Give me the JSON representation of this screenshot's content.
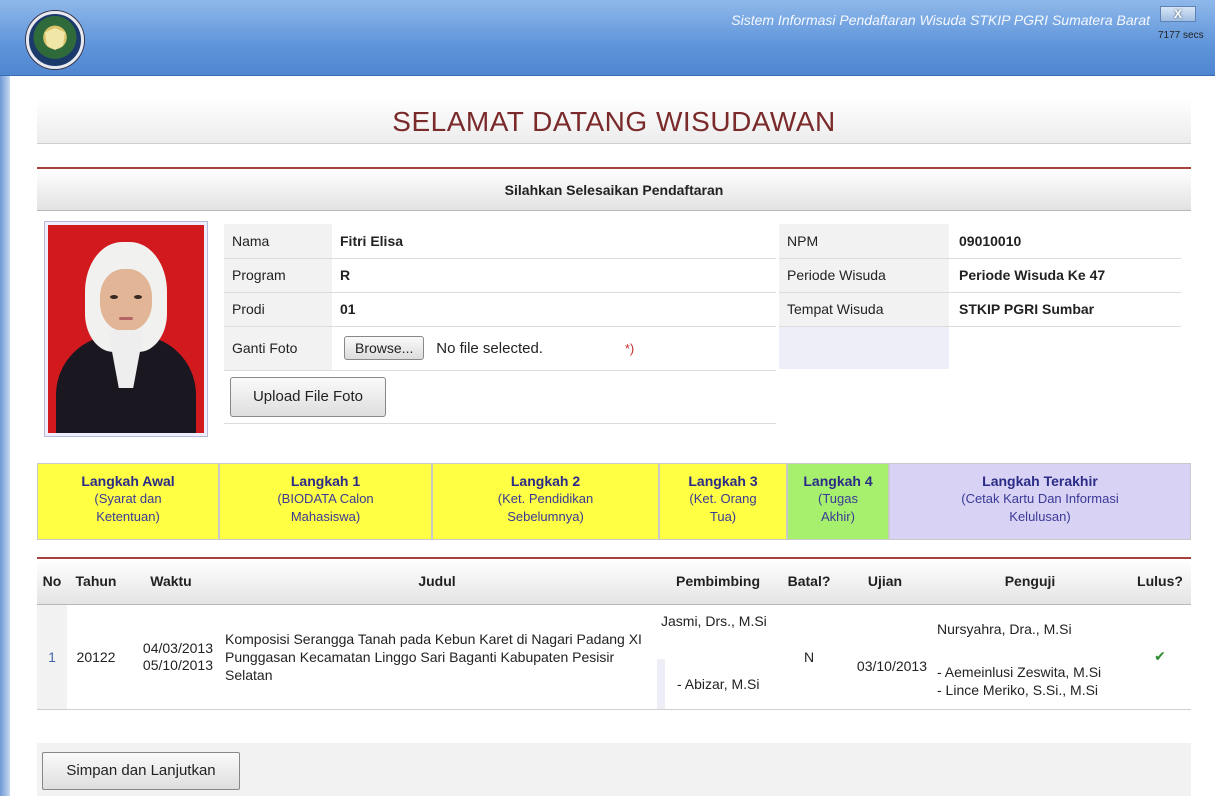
{
  "window": {
    "app_title": "Sistem Informasi Pendaftaran Wisuda STKIP PGRI Sumatera Barat",
    "close_label": "X",
    "timer": "7177 secs"
  },
  "welcome_title": "SELAMAT DATANG WISUDAWAN",
  "section_title": "Silahkan Selesaikan Pendaftaran",
  "profile": {
    "left": [
      {
        "label": "Nama",
        "value": "Fitri Elisa"
      },
      {
        "label": "Program",
        "value": "R"
      },
      {
        "label": "Prodi",
        "value": "01"
      }
    ],
    "right": [
      {
        "label": "NPM",
        "value": "09010010"
      },
      {
        "label": "Periode Wisuda",
        "value": "Periode Wisuda Ke 47"
      },
      {
        "label": "Tempat Wisuda",
        "value": "STKIP PGRI Sumbar"
      }
    ],
    "photo_label": "Ganti Foto",
    "browse_label": "Browse...",
    "no_file_text": "No file selected.",
    "required_mark": "*)",
    "upload_label": "Upload File Foto"
  },
  "steps": [
    {
      "title": "Langkah Awal",
      "desc": "(Syarat dan Ketentuan)",
      "color": "yellow"
    },
    {
      "title": "Langkah 1",
      "desc": "(BIODATA Calon Mahasiswa)",
      "color": "yellow"
    },
    {
      "title": "Langkah 2",
      "desc": "(Ket. Pendidikan Sebelumnya)",
      "color": "yellow"
    },
    {
      "title": "Langkah 3",
      "desc": "(Ket. Orang Tua)",
      "color": "yellow"
    },
    {
      "title": "Langkah 4",
      "desc": "(Tugas Akhir)",
      "color": "green"
    },
    {
      "title": "Langkah Terakhir",
      "desc": "(Cetak Kartu Dan Informasi Kelulusan)",
      "color": "purple"
    }
  ],
  "table": {
    "headers": [
      "No",
      "Tahun",
      "Waktu",
      "Judul",
      "Pembimbing",
      "Batal?",
      "Ujian",
      "Penguji",
      "Lulus?"
    ],
    "row": {
      "no": "1",
      "tahun": "20122",
      "waktu_start": "04/03/2013",
      "waktu_end": "05/10/2013",
      "judul": "Komposisi Serangga Tanah pada Kebun Karet di Nagari Padang XI Punggasan Kecamatan Linggo Sari Baganti Kabupaten Pesisir Selatan",
      "pembimbing_1": "Jasmi, Drs., M.Si",
      "pembimbing_2": "- Abizar, M.Si",
      "batal": "N",
      "ujian": "03/10/2013",
      "penguji_1": "Nursyahra, Dra., M.Si",
      "penguji_2": "- Aemeinlusi Zeswita, M.Si",
      "penguji_3": "- Lince Meriko, S.Si., M.Si",
      "lulus_icon": "checkmark-icon"
    }
  },
  "save_label": "Simpan dan Lanjutkan"
}
